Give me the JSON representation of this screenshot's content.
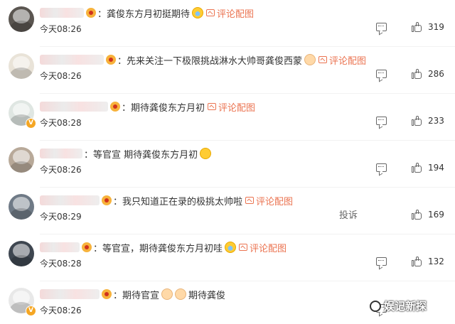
{
  "comments": [
    {
      "text": "龚俊东方月初挺期待",
      "time": "今天08:26",
      "likes": "319",
      "has_pic": true,
      "pic_label": "评论配图",
      "emoji": "grinning-sweat-emoji"
    },
    {
      "text": "先来关注一下极限挑战淋水大帅哥龚俊西蒙",
      "time": "今天08:26",
      "likes": "286",
      "has_pic": true,
      "pic_label": "评论配图",
      "emoji": "cheer-emoji"
    },
    {
      "text": "期待龚俊东方月初",
      "time": "今天08:28",
      "likes": "233",
      "has_pic": true,
      "pic_label": "评论配图"
    },
    {
      "text": "等官宣 期待龚俊东方月初",
      "time": "今天08:26",
      "likes": "194",
      "has_pic": false,
      "emoji": "clapping-emoji"
    },
    {
      "text": "我只知道正在录的极挑太帅啦",
      "time": "今天08:29",
      "likes": "169",
      "has_pic": true,
      "pic_label": "评论配图",
      "report": "投诉"
    },
    {
      "text": "等官宣，期待龚俊东方月初哇",
      "time": "今天08:28",
      "likes": "132",
      "has_pic": true,
      "pic_label": "评论配图",
      "emoji": "crying-emoji"
    },
    {
      "text_before": "期待官宣",
      "text_after": "期待龚俊",
      "time": "今天08:26",
      "has_pic": false
    }
  ],
  "watermark": "娱记新探",
  "colors": {
    "link": "#eb7350",
    "text": "#333333",
    "badge": "#f5a623"
  }
}
